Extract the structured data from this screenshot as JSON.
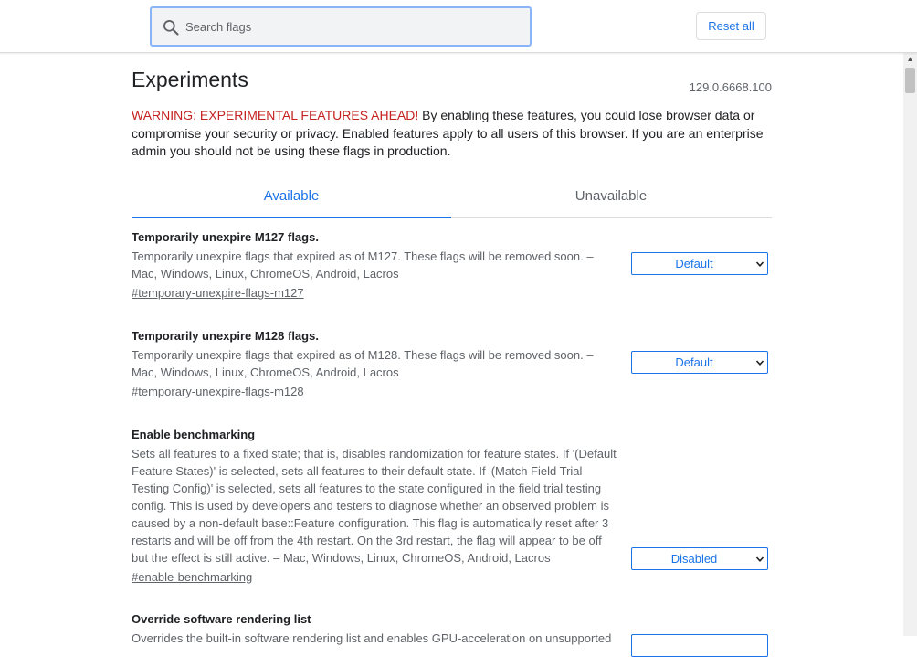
{
  "search": {
    "placeholder": "Search flags",
    "value": ""
  },
  "header": {
    "reset_label": "Reset all"
  },
  "page": {
    "title": "Experiments",
    "version": "129.0.6668.100",
    "warning_strong": "WARNING: EXPERIMENTAL FEATURES AHEAD!",
    "warning_text": " By enabling these features, you could lose browser data or compromise your security or privacy. Enabled features apply to all users of this browser. If you are an enterprise admin you should not be using these flags in production."
  },
  "tabs": [
    {
      "label": "Available",
      "active": true
    },
    {
      "label": "Unavailable",
      "active": false
    }
  ],
  "flags": [
    {
      "title": "Temporarily unexpire M127 flags.",
      "description": "Temporarily unexpire flags that expired as of M127. These flags will be removed soon. – Mac, Windows, Linux, ChromeOS, Android, Lacros",
      "link": "#temporary-unexpire-flags-m127",
      "value": "Default"
    },
    {
      "title": "Temporarily unexpire M128 flags.",
      "description": "Temporarily unexpire flags that expired as of M128. These flags will be removed soon. – Mac, Windows, Linux, ChromeOS, Android, Lacros",
      "link": "#temporary-unexpire-flags-m128",
      "value": "Default"
    },
    {
      "title": "Enable benchmarking",
      "description": "Sets all features to a fixed state; that is, disables randomization for feature states. If '(Default Feature States)' is selected, sets all features to their default state. If '(Match Field Trial Testing Config)' is selected, sets all features to the state configured in the field trial testing config. This is used by developers and testers to diagnose whether an observed problem is caused by a non-default base::Feature configuration. This flag is automatically reset after 3 restarts and will be off from the 4th restart. On the 3rd restart, the flag will appear to be off but the effect is still active. – Mac, Windows, Linux, ChromeOS, Android, Lacros",
      "link": "#enable-benchmarking",
      "value": "Disabled"
    },
    {
      "title": "Override software rendering list",
      "description": "Overrides the built-in software rendering list and enables GPU-acceleration on unsupported",
      "link": "",
      "value": ""
    }
  ],
  "colors": {
    "accent": "#1a73e8",
    "warning": "#c5221f",
    "text_secondary": "#5f6368"
  },
  "icons": {
    "search": "search-icon",
    "chevron": "chevron-down-icon",
    "scroll_up": "scroll-up-arrow-icon"
  }
}
